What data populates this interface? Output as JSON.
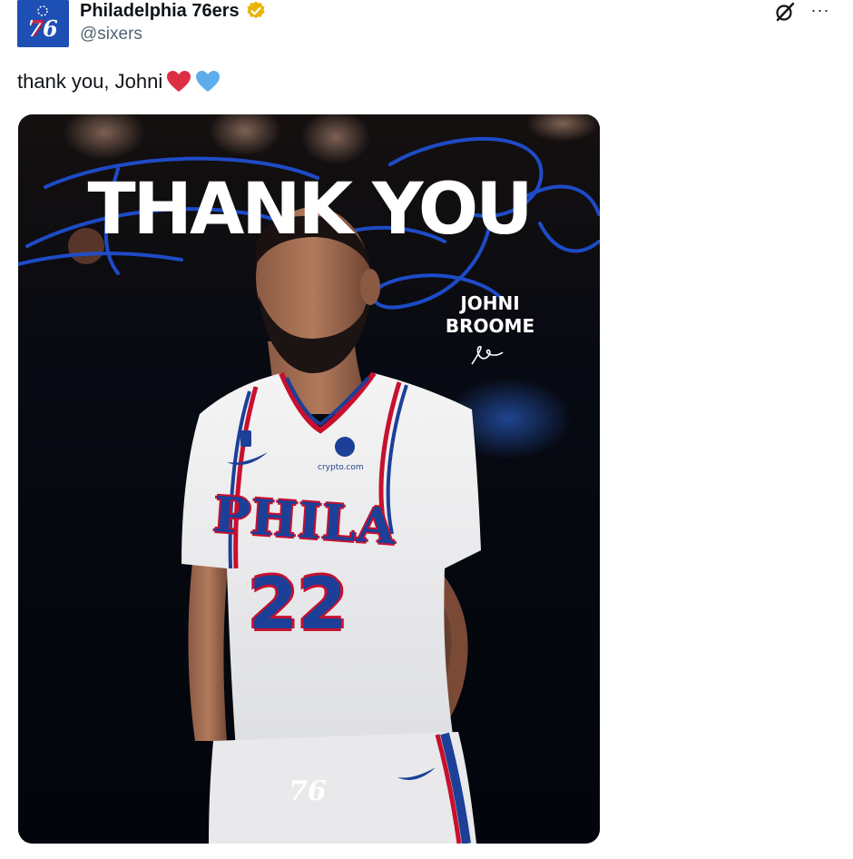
{
  "account": {
    "display_name": "Philadelphia 76ers",
    "handle": "@sixers",
    "avatar_text": "76",
    "verified_icon": "verified-badge-icon",
    "verified_color": "#f4c20d"
  },
  "actions": {
    "grok_icon": "grok-icon",
    "more_label": "···"
  },
  "tweet": {
    "text": "thank you, Johni",
    "emojis": [
      "red-heart",
      "blue-heart"
    ]
  },
  "media": {
    "headline": "THANK YOU",
    "script_overlay": "Thank You",
    "player_first_name": "JOHNI",
    "player_last_name": "BROOME",
    "jersey_team": "PHILA",
    "jersey_number": "22",
    "sponsor": "crypto.com",
    "team_logo": "76"
  },
  "colors": {
    "brand_blue": "#1d4fb5",
    "brand_red": "#c8102e",
    "text_primary": "#0f1419",
    "text_secondary": "#536471"
  }
}
